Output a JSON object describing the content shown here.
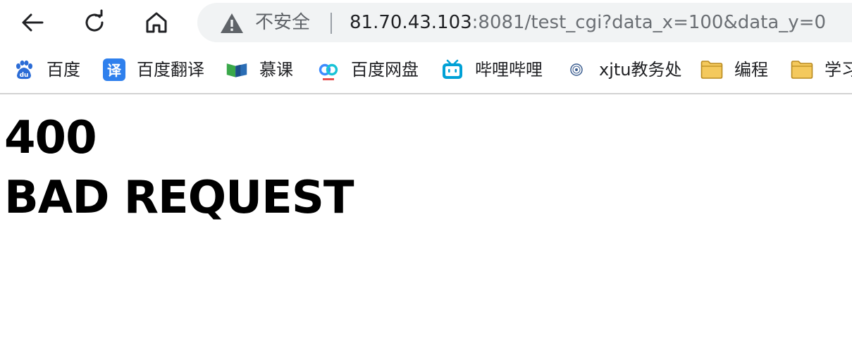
{
  "nav": {
    "back_icon": "arrow-left-icon",
    "reload_icon": "reload-icon",
    "home_icon": "home-icon"
  },
  "omnibox": {
    "security_icon": "warning-triangle-icon",
    "security_text": "不安全",
    "url_host": "81.70.43.103",
    "url_rest": ":8081/test_cgi?data_x=100&data_y=0"
  },
  "bookmarks": [
    {
      "label": "百度",
      "icon": "baidu-paw-icon"
    },
    {
      "label": "百度翻译",
      "icon": "baidu-translate-icon"
    },
    {
      "label": "慕课",
      "icon": "mooc-icon"
    },
    {
      "label": "百度网盘",
      "icon": "baidu-netdisk-icon"
    },
    {
      "label": "哔哩哔哩",
      "icon": "bilibili-icon"
    },
    {
      "label": "xjtu教务处",
      "icon": "xjtu-seal-icon"
    },
    {
      "label": "编程",
      "icon": "folder-icon"
    },
    {
      "label": "学习",
      "icon": "folder-icon"
    }
  ],
  "page": {
    "code": "400",
    "title": "BAD REQUEST"
  },
  "colors": {
    "omnibox_bg": "#f1f3f4",
    "folder": "#f4c95d",
    "baidu_blue": "#2b6cd6",
    "bilibili": "#00a1d6"
  }
}
